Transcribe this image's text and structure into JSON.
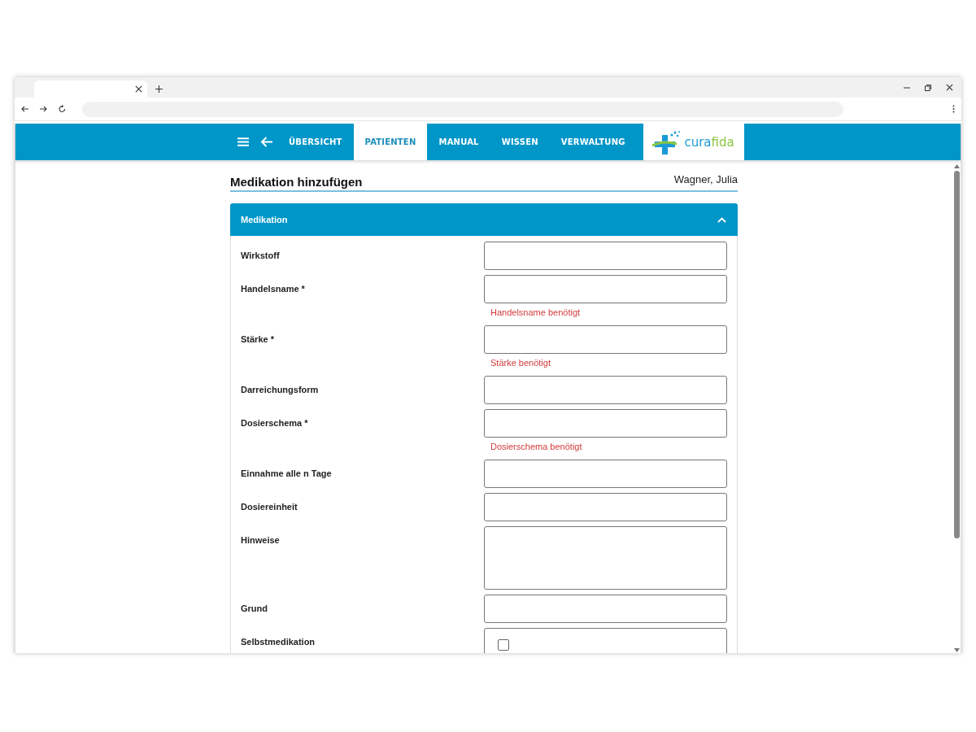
{
  "nav": {
    "items": [
      {
        "label": "ÜBERSICHT",
        "selected": false
      },
      {
        "label": "PATIENTEN",
        "selected": true
      },
      {
        "label": "MANUAL",
        "selected": false
      },
      {
        "label": "WISSEN",
        "selected": false
      },
      {
        "label": "VERWALTUNG",
        "selected": false
      }
    ],
    "logo_text": [
      "cura",
      "fida"
    ]
  },
  "page": {
    "title": "Medikation hinzufügen",
    "patient": "Wagner, Julia"
  },
  "section": {
    "title": "Medikation",
    "expanded": true,
    "fields": [
      {
        "label": "Wirkstoff",
        "kind": "text"
      },
      {
        "label": "Handelsname *",
        "kind": "text",
        "error": "Handelsname benötigt"
      },
      {
        "label": "Stärke *",
        "kind": "text",
        "error": "Stärke benötigt"
      },
      {
        "label": "Darreichungsform",
        "kind": "text"
      },
      {
        "label": "Dosierschema *",
        "kind": "text",
        "error": "Dosierschema benötigt"
      },
      {
        "label": "Einnahme alle n Tage",
        "kind": "text"
      },
      {
        "label": "Dosiereinheit",
        "kind": "text"
      },
      {
        "label": "Hinweise",
        "kind": "textarea"
      },
      {
        "label": "Grund",
        "kind": "text"
      },
      {
        "label": "Selbstmedikation",
        "kind": "checkbox",
        "checked": false
      }
    ]
  }
}
